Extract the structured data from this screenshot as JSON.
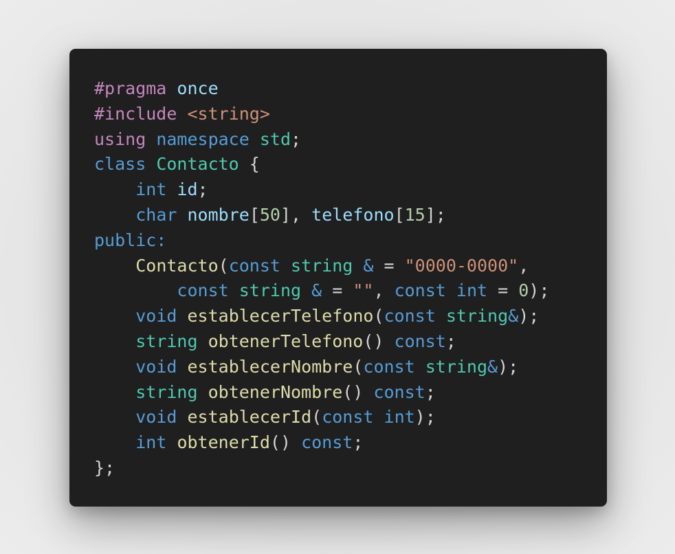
{
  "colors": {
    "background": "#e6e6e6",
    "card": "#1f1f1f",
    "default": "#d4d4d4",
    "preprocessor": "#c586c0",
    "keyword": "#569cd6",
    "type": "#4ec9b0",
    "function": "#dcdcaa",
    "variable": "#9cdcfe",
    "string": "#ce9178",
    "number": "#b5cea8"
  },
  "code": {
    "language": "cpp",
    "lines": [
      [
        {
          "t": "#pragma",
          "c": "#c586c0"
        },
        {
          "t": " ",
          "c": "#d4d4d4"
        },
        {
          "t": "once",
          "c": "#9cdcfe"
        }
      ],
      [
        {
          "t": "#include",
          "c": "#c586c0"
        },
        {
          "t": " ",
          "c": "#d4d4d4"
        },
        {
          "t": "<string>",
          "c": "#ce9178"
        }
      ],
      [
        {
          "t": "using",
          "c": "#c586c0"
        },
        {
          "t": " ",
          "c": "#d4d4d4"
        },
        {
          "t": "namespace",
          "c": "#569cd6"
        },
        {
          "t": " ",
          "c": "#d4d4d4"
        },
        {
          "t": "std",
          "c": "#4ec9b0"
        },
        {
          "t": ";",
          "c": "#d4d4d4"
        }
      ],
      [
        {
          "t": "class",
          "c": "#569cd6"
        },
        {
          "t": " ",
          "c": "#d4d4d4"
        },
        {
          "t": "Contacto",
          "c": "#4ec9b0"
        },
        {
          "t": " {",
          "c": "#d4d4d4"
        }
      ],
      [
        {
          "t": "    ",
          "c": "#d4d4d4"
        },
        {
          "t": "int",
          "c": "#569cd6"
        },
        {
          "t": " ",
          "c": "#d4d4d4"
        },
        {
          "t": "id",
          "c": "#9cdcfe"
        },
        {
          "t": ";",
          "c": "#d4d4d4"
        }
      ],
      [
        {
          "t": "    ",
          "c": "#d4d4d4"
        },
        {
          "t": "char",
          "c": "#569cd6"
        },
        {
          "t": " ",
          "c": "#d4d4d4"
        },
        {
          "t": "nombre",
          "c": "#9cdcfe"
        },
        {
          "t": "[",
          "c": "#d4d4d4"
        },
        {
          "t": "50",
          "c": "#b5cea8"
        },
        {
          "t": "], ",
          "c": "#d4d4d4"
        },
        {
          "t": "telefono",
          "c": "#9cdcfe"
        },
        {
          "t": "[",
          "c": "#d4d4d4"
        },
        {
          "t": "15",
          "c": "#b5cea8"
        },
        {
          "t": "];",
          "c": "#d4d4d4"
        }
      ],
      [
        {
          "t": "public:",
          "c": "#569cd6"
        }
      ],
      [
        {
          "t": "    ",
          "c": "#d4d4d4"
        },
        {
          "t": "Contacto",
          "c": "#dcdcaa"
        },
        {
          "t": "(",
          "c": "#d4d4d4"
        },
        {
          "t": "const",
          "c": "#569cd6"
        },
        {
          "t": " ",
          "c": "#d4d4d4"
        },
        {
          "t": "string",
          "c": "#4ec9b0"
        },
        {
          "t": " ",
          "c": "#d4d4d4"
        },
        {
          "t": "&",
          "c": "#569cd6"
        },
        {
          "t": " = ",
          "c": "#d4d4d4"
        },
        {
          "t": "\"0000-0000\"",
          "c": "#ce9178"
        },
        {
          "t": ",",
          "c": "#d4d4d4"
        }
      ],
      [
        {
          "t": "        ",
          "c": "#d4d4d4"
        },
        {
          "t": "const",
          "c": "#569cd6"
        },
        {
          "t": " ",
          "c": "#d4d4d4"
        },
        {
          "t": "string",
          "c": "#4ec9b0"
        },
        {
          "t": " ",
          "c": "#d4d4d4"
        },
        {
          "t": "&",
          "c": "#569cd6"
        },
        {
          "t": " = ",
          "c": "#d4d4d4"
        },
        {
          "t": "\"\"",
          "c": "#ce9178"
        },
        {
          "t": ", ",
          "c": "#d4d4d4"
        },
        {
          "t": "const",
          "c": "#569cd6"
        },
        {
          "t": " ",
          "c": "#d4d4d4"
        },
        {
          "t": "int",
          "c": "#569cd6"
        },
        {
          "t": " = ",
          "c": "#d4d4d4"
        },
        {
          "t": "0",
          "c": "#b5cea8"
        },
        {
          "t": ");",
          "c": "#d4d4d4"
        }
      ],
      [
        {
          "t": "    ",
          "c": "#d4d4d4"
        },
        {
          "t": "void",
          "c": "#569cd6"
        },
        {
          "t": " ",
          "c": "#d4d4d4"
        },
        {
          "t": "establecerTelefono",
          "c": "#dcdcaa"
        },
        {
          "t": "(",
          "c": "#d4d4d4"
        },
        {
          "t": "const",
          "c": "#569cd6"
        },
        {
          "t": " ",
          "c": "#d4d4d4"
        },
        {
          "t": "string",
          "c": "#4ec9b0"
        },
        {
          "t": "&",
          "c": "#569cd6"
        },
        {
          "t": ");",
          "c": "#d4d4d4"
        }
      ],
      [
        {
          "t": "    ",
          "c": "#d4d4d4"
        },
        {
          "t": "string",
          "c": "#4ec9b0"
        },
        {
          "t": " ",
          "c": "#d4d4d4"
        },
        {
          "t": "obtenerTelefono",
          "c": "#dcdcaa"
        },
        {
          "t": "() ",
          "c": "#d4d4d4"
        },
        {
          "t": "const",
          "c": "#569cd6"
        },
        {
          "t": ";",
          "c": "#d4d4d4"
        }
      ],
      [
        {
          "t": "    ",
          "c": "#d4d4d4"
        },
        {
          "t": "void",
          "c": "#569cd6"
        },
        {
          "t": " ",
          "c": "#d4d4d4"
        },
        {
          "t": "establecerNombre",
          "c": "#dcdcaa"
        },
        {
          "t": "(",
          "c": "#d4d4d4"
        },
        {
          "t": "const",
          "c": "#569cd6"
        },
        {
          "t": " ",
          "c": "#d4d4d4"
        },
        {
          "t": "string",
          "c": "#4ec9b0"
        },
        {
          "t": "&",
          "c": "#569cd6"
        },
        {
          "t": ");",
          "c": "#d4d4d4"
        }
      ],
      [
        {
          "t": "    ",
          "c": "#d4d4d4"
        },
        {
          "t": "string",
          "c": "#4ec9b0"
        },
        {
          "t": " ",
          "c": "#d4d4d4"
        },
        {
          "t": "obtenerNombre",
          "c": "#dcdcaa"
        },
        {
          "t": "() ",
          "c": "#d4d4d4"
        },
        {
          "t": "const",
          "c": "#569cd6"
        },
        {
          "t": ";",
          "c": "#d4d4d4"
        }
      ],
      [
        {
          "t": "    ",
          "c": "#d4d4d4"
        },
        {
          "t": "void",
          "c": "#569cd6"
        },
        {
          "t": " ",
          "c": "#d4d4d4"
        },
        {
          "t": "establecerId",
          "c": "#dcdcaa"
        },
        {
          "t": "(",
          "c": "#d4d4d4"
        },
        {
          "t": "const",
          "c": "#569cd6"
        },
        {
          "t": " ",
          "c": "#d4d4d4"
        },
        {
          "t": "int",
          "c": "#569cd6"
        },
        {
          "t": ");",
          "c": "#d4d4d4"
        }
      ],
      [
        {
          "t": "    ",
          "c": "#d4d4d4"
        },
        {
          "t": "int",
          "c": "#569cd6"
        },
        {
          "t": " ",
          "c": "#d4d4d4"
        },
        {
          "t": "obtenerId",
          "c": "#dcdcaa"
        },
        {
          "t": "() ",
          "c": "#d4d4d4"
        },
        {
          "t": "const",
          "c": "#569cd6"
        },
        {
          "t": ";",
          "c": "#d4d4d4"
        }
      ],
      [
        {
          "t": "};",
          "c": "#d4d4d4"
        }
      ]
    ]
  }
}
